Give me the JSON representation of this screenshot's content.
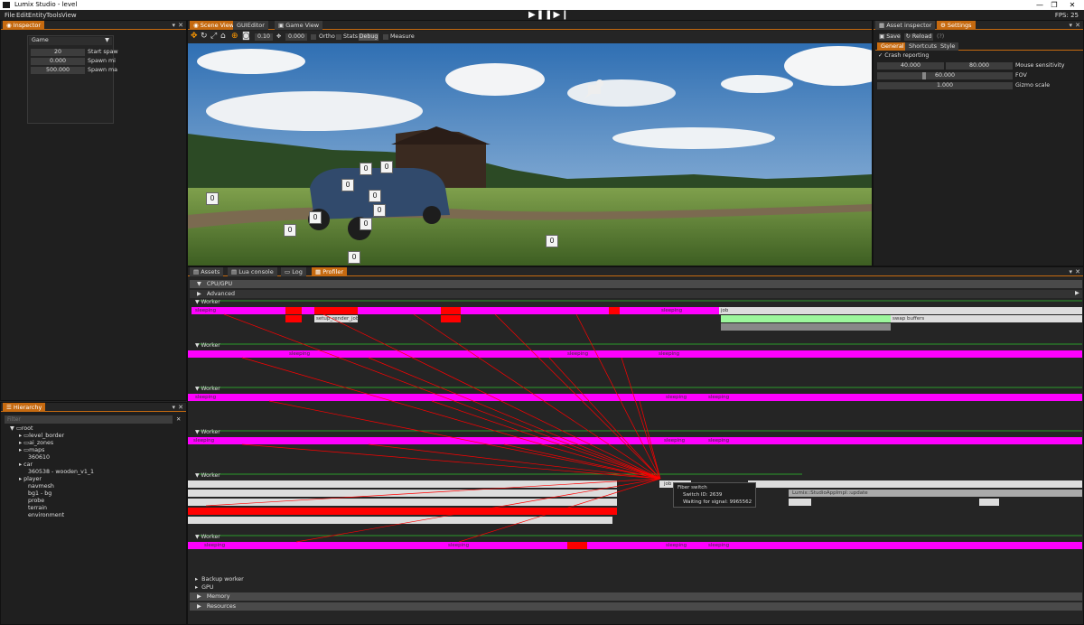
{
  "window": {
    "title": "Lumix Studio - level",
    "fps": "FPS: 25"
  },
  "menu": [
    "File",
    "Edit",
    "Entity",
    "Tools",
    "View"
  ],
  "playback": {
    "play": "▶",
    "pause": "❚❚",
    "next": "▶❙"
  },
  "inspector": {
    "tab": "Inspector",
    "component": "Game",
    "props": [
      {
        "value": "20",
        "label": "Start spaw"
      },
      {
        "value": "0.000",
        "label": "Spawn mi"
      },
      {
        "value": "500.000",
        "label": "Spawn ma"
      }
    ]
  },
  "hierarchy": {
    "tab": "Hierarchy",
    "filter_placeholder": "Filter",
    "items": [
      "root",
      "level_border",
      "ai_zones",
      "maps",
      "360610",
      "car",
      "360538 - wooden_v1_1",
      "player",
      "navmesh",
      "bg1 - bg",
      "probe",
      "terrain",
      "environment"
    ]
  },
  "scene": {
    "tabs": [
      "Scene View",
      "GUIEditor",
      "Game View"
    ],
    "toolbar": {
      "speed": "0.10",
      "rotation": "0.000",
      "ortho": "Ortho",
      "stats": "Stats",
      "debug": "Debug",
      "measure": "Measure"
    },
    "badges": [
      "0",
      "0",
      "0",
      "0",
      "0",
      "0",
      "0",
      "0",
      "0",
      "0",
      "0"
    ]
  },
  "asset_inspector": {
    "tabs": [
      "Asset inspector",
      "Settings"
    ],
    "save": "Save",
    "reload": "Reload",
    "sub_tabs": [
      "General",
      "Shortcuts",
      "Style"
    ],
    "crash_reporting": "Crash reporting",
    "mouse_min": "40.000",
    "mouse_max": "80.000",
    "mouse_label": "Mouse sensitivity",
    "fov": "60.000",
    "fov_label": "FOV",
    "gizmo": "1.000",
    "gizmo_label": "Gizmo scale"
  },
  "bottom": {
    "tabs": [
      "Assets",
      "Lua console",
      "Log",
      "Profiler"
    ],
    "sections": {
      "cpu": "CPU/GPU",
      "advanced": "Advanced",
      "backup": "Backup worker",
      "gpu": "GPU",
      "memory": "Memory",
      "resources": "Resources"
    },
    "worker": "Worker",
    "sleeping": "sleeping",
    "job": "job",
    "setup_render": "setup_render_job",
    "swap": "swap buffers",
    "studio_update": "Lumix::StudioAppImpl::update",
    "tooltip": {
      "title": "Fiber switch",
      "switch": "Switch ID: 2639",
      "waiting": "Waiting for signal: 9965562"
    }
  },
  "colors": {
    "accent": "#c66a10",
    "magenta": "#ff00ff",
    "red": "#ff0000",
    "green": "#9cf79c"
  }
}
